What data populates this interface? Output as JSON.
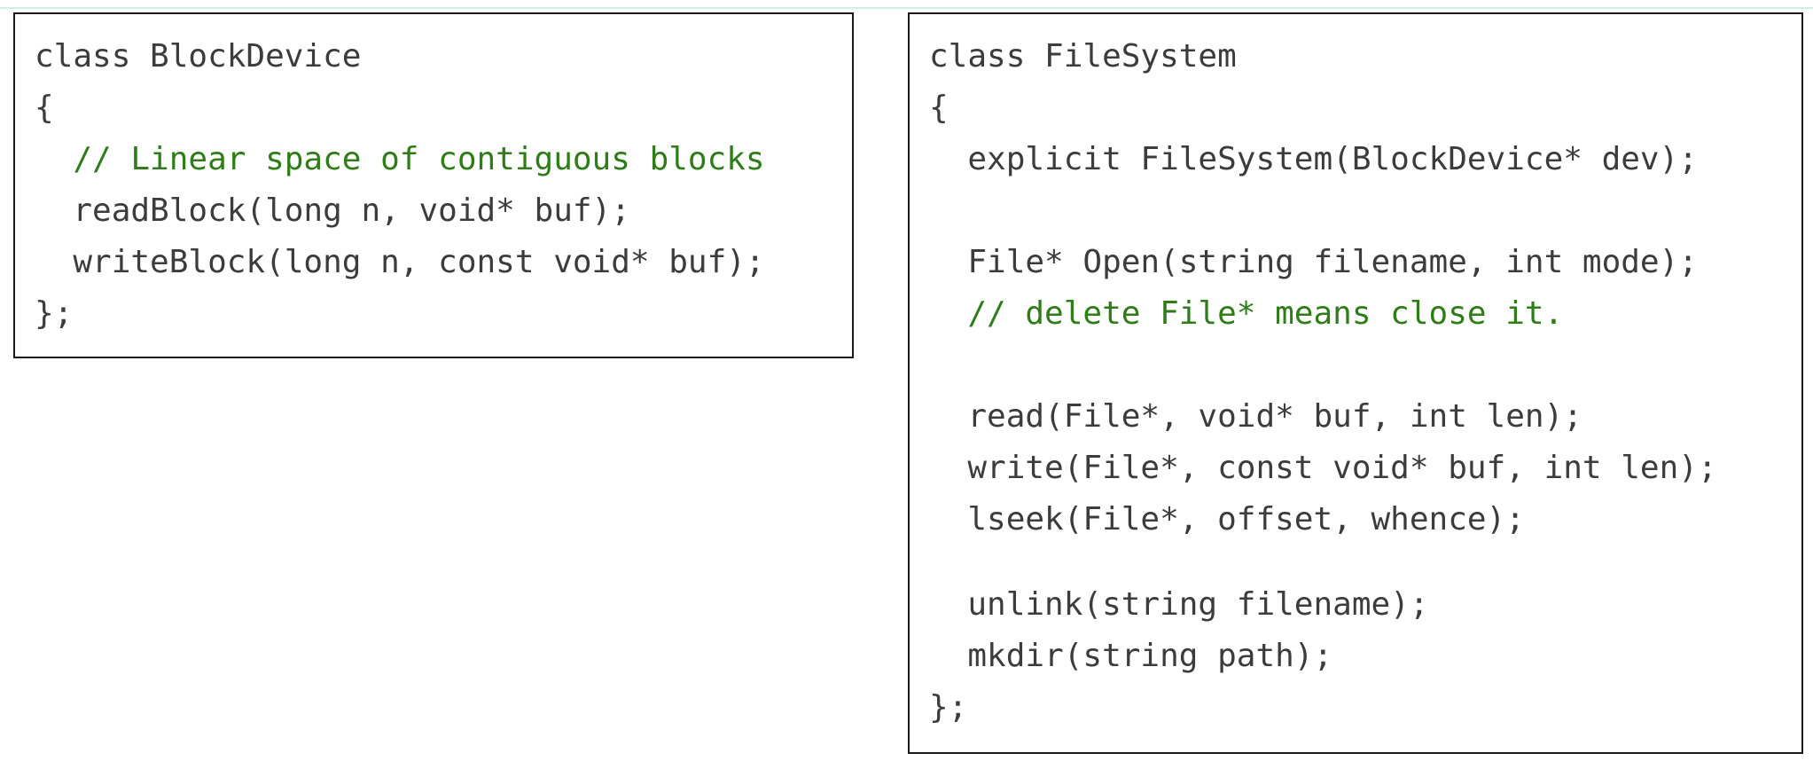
{
  "block_device": {
    "lines": [
      {
        "text": "class BlockDevice",
        "kind": "code"
      },
      {
        "text": "{",
        "kind": "code"
      },
      {
        "text": "  // Linear space of contiguous blocks",
        "kind": "comment"
      },
      {
        "text": "  readBlock(long n, void* buf);",
        "kind": "code"
      },
      {
        "text": "  writeBlock(long n, const void* buf);",
        "kind": "code"
      },
      {
        "text": "};",
        "kind": "code"
      }
    ]
  },
  "file_system": {
    "lines": [
      {
        "text": "class FileSystem",
        "kind": "code"
      },
      {
        "text": "{",
        "kind": "code"
      },
      {
        "text": "  explicit FileSystem(BlockDevice* dev);",
        "kind": "code"
      },
      {
        "text": "  File* Open(string filename, int mode);",
        "kind": "code"
      },
      {
        "text": "  // delete File* means close it.",
        "kind": "comment"
      },
      {
        "text": "  read(File*, void* buf, int len);",
        "kind": "code"
      },
      {
        "text": "  write(File*, const void* buf, int len);",
        "kind": "code"
      },
      {
        "text": "  lseek(File*, offset, whence);",
        "kind": "code"
      },
      {
        "text": "  unlink(string filename);",
        "kind": "code"
      },
      {
        "text": "  mkdir(string path);",
        "kind": "code"
      },
      {
        "text": "};",
        "kind": "code"
      }
    ]
  },
  "colors": {
    "code_text": "#3c3c3c",
    "comment_text": "#2e7d18",
    "box_border": "#1a1a1a"
  }
}
